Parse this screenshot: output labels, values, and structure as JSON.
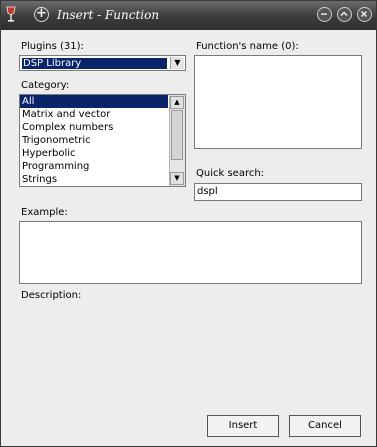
{
  "window": {
    "title": "Insert - Function"
  },
  "plugins": {
    "label": "Plugins (31):",
    "selected": "DSP Library"
  },
  "category": {
    "label": "Category:",
    "items": [
      "All",
      "Matrix and vector",
      "Complex numbers",
      "Trigonometric",
      "Hyperbolic",
      "Programming",
      "Strings"
    ],
    "selected_index": 0
  },
  "functions": {
    "label": "Function's name (0):"
  },
  "quick_search": {
    "label": "Quick search:",
    "value": "dspl"
  },
  "example": {
    "label": "Example:"
  },
  "description": {
    "label": "Description:"
  },
  "buttons": {
    "insert": "Insert",
    "cancel": "Cancel"
  },
  "colors": {
    "selection": "#0a246a",
    "titlebar": "#3b3b3b"
  }
}
